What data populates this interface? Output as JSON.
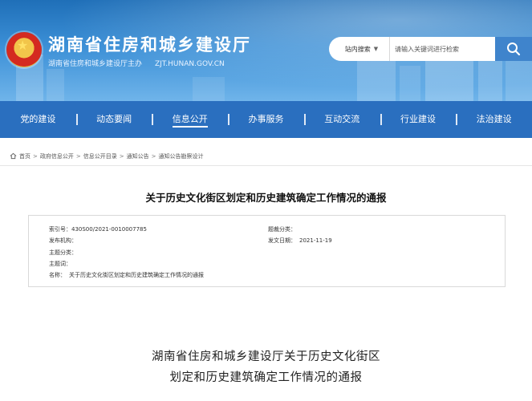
{
  "header": {
    "site_title": "湖南省住房和城乡建设厅",
    "sponsor": "湖南省住房和城乡建设厅主办",
    "domain": "ZJT.HUNAN.GOV.CN",
    "search_scope": "站内搜索",
    "search_placeholder": "请输入关键词进行检索"
  },
  "nav": {
    "items": [
      {
        "label": "党的建设"
      },
      {
        "label": "动态要闻"
      },
      {
        "label": "信息公开",
        "active": true
      },
      {
        "label": "办事服务"
      },
      {
        "label": "互动交流"
      },
      {
        "label": "行业建设"
      },
      {
        "label": "法治建设"
      }
    ]
  },
  "breadcrumb": {
    "items": [
      "首页",
      "政府信息公开",
      "信息公开目录",
      "通知公告",
      "通知公告勘察设计"
    ]
  },
  "doc": {
    "title": "关于历史文化街区划定和历史建筑确定工作情况的通报",
    "meta": {
      "index_label": "索引号：",
      "index_value": "430S00/2021-0010007785",
      "topic_label": "题裁分类：",
      "topic_value": "",
      "publisher_label": "发布机构：",
      "publisher_value": "",
      "date_label": "发文日期：",
      "date_value": "2021-11-19",
      "subject_label": "主题分类：",
      "subject_value": "",
      "keywords_label": "主题词：",
      "keywords_value": "",
      "name_label": "名称：",
      "name_value": "关于历史文化街区划定和历史建筑确定工作情况的通报"
    },
    "body_heading_line1": "湖南省住房和城乡建设厅关于历史文化街区",
    "body_heading_line2": "划定和历史建筑确定工作情况的通报"
  },
  "colors": {
    "nav_bg": "#2a6fbf",
    "header_top": "#1f6fb8",
    "search_button": "#3f84cc"
  }
}
